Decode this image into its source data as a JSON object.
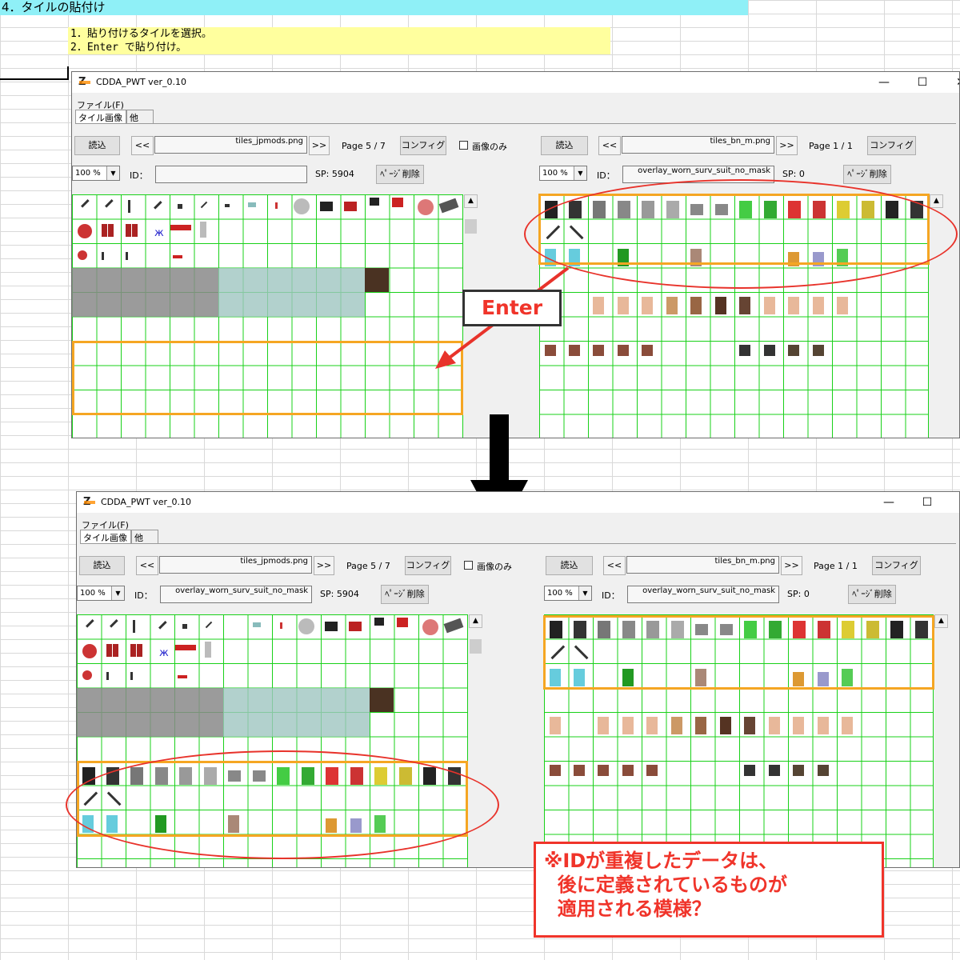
{
  "sheet": {
    "title": "4．タイルの貼付け",
    "step1": "1．貼り付けるタイルを選択。",
    "step2": "2．Enter で貼り付け。"
  },
  "window": {
    "app_title": "CDDA_PWT  ver_0.10",
    "menu_file": "ファイル(F)",
    "tab_images": "タイル画像",
    "tab_other": "他",
    "minimize": "—",
    "maximize": "☐",
    "close": "✕"
  },
  "left_panel": {
    "load_label": "読込",
    "prev_label": "<<",
    "next_label": ">>",
    "file_name": "tiles_jpmods.png",
    "page": "Page 5 / 7",
    "config_label": "コンフィグ",
    "image_only_label": "画像のみ",
    "zoom": "100 %",
    "id_label": "ID：",
    "sp": "SP: 5904",
    "delete_page_label": "ﾍﾟｰｼﾞ削除"
  },
  "right_panel": {
    "load_label": "読込",
    "prev_label": "<<",
    "next_label": ">>",
    "file_name": "tiles_bn_m.png",
    "page": "Page 1 / 1",
    "config_label": "コンフィグ",
    "zoom": "100 %",
    "id_label": "ID：",
    "id_value": "overlay_worn_surv_suit_no_mask",
    "sp": "SP: 0",
    "delete_page_label": "ﾍﾟｰｼﾞ削除"
  },
  "top_window": {
    "left_id_value": ""
  },
  "bottom_window": {
    "left_id_value": "overlay_worn_surv_suit_no_mask"
  },
  "enter_label": "Enter",
  "note": {
    "line1": "※IDが重複したデータは、",
    "line2": "  後に定義されているものが",
    "line3": "  適用される模様？"
  },
  "colors": {
    "highlight_orange": "#f5a623",
    "annotation_red": "#e8332b",
    "grid_green": "#19d119",
    "sheet_title_bg": "#8ff0f7",
    "step_bg": "#ffff9e"
  }
}
